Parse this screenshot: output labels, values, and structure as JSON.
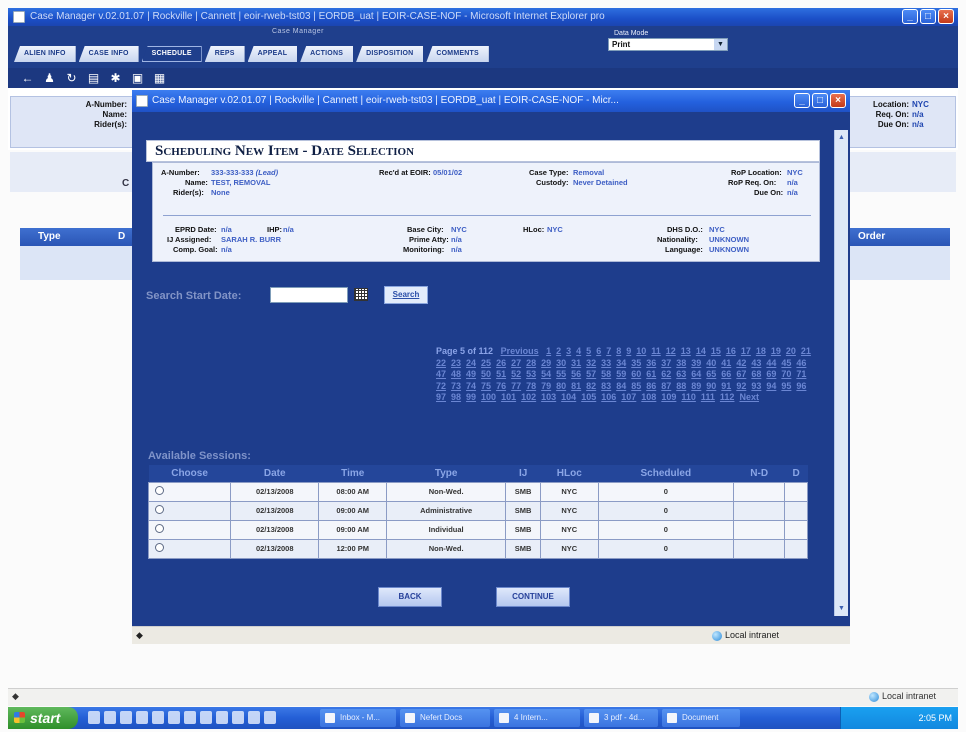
{
  "outer_window": {
    "title": "Case Manager v.02.01.07 | Rockville | Cannett | eoir-rweb-tst03 | EORDB_uat | EOIR-CASE-NOF - Microsoft Internet Explorer pro",
    "header_label": "Case Manager",
    "data_mode_label": "Data Mode",
    "print_select_value": "Print",
    "tabs": [
      {
        "label": "Alien Info"
      },
      {
        "label": "Case Info"
      },
      {
        "label": "Schedule"
      },
      {
        "label": "Reps"
      },
      {
        "label": "Appeal"
      },
      {
        "label": "Actions"
      },
      {
        "label": "Disposition"
      },
      {
        "label": "Comments"
      }
    ],
    "toolbar_icons": [
      "back-arrow-icon",
      "person-icon",
      "refresh-icon",
      "document-icon",
      "settings-icon",
      "save-icon",
      "clipboard-icon"
    ],
    "bg_labels": {
      "a_number": "A-Number:",
      "name": "Name:",
      "riders": "Rider(s):"
    },
    "bg_right": {
      "location_label": "Location:",
      "location_value": "NYC",
      "req_label": "Req. On:",
      "req_value": "n/a",
      "due_label": "Due On:",
      "due_value": "n/a"
    },
    "bg_grid": {
      "type_label": "Type",
      "col2_label": "D",
      "order_label": "Order"
    },
    "bg_strip_letter": "C",
    "status_text": "Local intranet"
  },
  "modal": {
    "title": "Case Manager v.02.01.07 | Rockville | Cannett | eoir-rweb-tst03 | EORDB_uat | EOIR-CASE-NOF - Micr...",
    "header": "Scheduling New Item - Date Selection",
    "info": {
      "a_number_label": "A-Number:",
      "a_number_value": "333-333-333",
      "a_number_tag": "(Lead)",
      "recd_label": "Rec'd at EOIR:",
      "recd_value": "05/01/02",
      "case_type_label": "Case Type:",
      "case_type_value": "Removal",
      "rop_location_label": "RoP Location:",
      "rop_location_value": "NYC",
      "name_label": "Name:",
      "name_value": "TEST, REMOVAL",
      "custody_label": "Custody:",
      "custody_value": "Never Detained",
      "rop_req_label": "RoP Req. On:",
      "rop_req_value": "n/a",
      "riders_label": "Rider(s):",
      "riders_value": "None",
      "due_label": "Due On:",
      "due_value": "n/a",
      "eprd_label": "EPRD Date:",
      "eprd_value": "n/a",
      "ihp_label": "IHP:",
      "ihp_value": "n/a",
      "base_city_label": "Base City:",
      "base_city_value": "NYC",
      "hloc_label": "HLoc:",
      "hloc_value": "NYC",
      "dhs_label": "DHS D.O.:",
      "dhs_value": "NYC",
      "ij_label": "IJ Assigned:",
      "ij_value": "SARAH R. BURR",
      "prime_atty_label": "Prime Atty:",
      "prime_atty_value": "n/a",
      "nationality_label": "Nationality:",
      "nationality_value": "UNKNOWN",
      "comp_goal_label": "Comp. Goal:",
      "comp_goal_value": "n/a",
      "monitoring_label": "Monitoring:",
      "monitoring_value": "n/a",
      "language_label": "Language:",
      "language_value": "UNKNOWN"
    },
    "search": {
      "label": "Search Start Date:",
      "value": "",
      "go_label": "Search"
    },
    "pager": {
      "page_info": "Page 5 of 112",
      "previous": "Previous",
      "next": "Next",
      "pages": [
        "1",
        "2",
        "3",
        "4",
        "5",
        "6",
        "7",
        "8",
        "9",
        "10",
        "11",
        "12",
        "13",
        "14",
        "15",
        "16",
        "17",
        "18",
        "19",
        "20",
        "21",
        "22",
        "23",
        "24",
        "25",
        "26",
        "27",
        "28",
        "29",
        "30",
        "31",
        "32",
        "33",
        "34",
        "35",
        "36",
        "37",
        "38",
        "39",
        "40",
        "41",
        "42",
        "43",
        "44",
        "45",
        "46",
        "47",
        "48",
        "49",
        "50",
        "51",
        "52",
        "53",
        "54",
        "55",
        "56",
        "57",
        "58",
        "59",
        "60",
        "61",
        "62",
        "63",
        "64",
        "65",
        "66",
        "67",
        "68",
        "69",
        "70",
        "71",
        "72",
        "73",
        "74",
        "75",
        "76",
        "77",
        "78",
        "79",
        "80",
        "81",
        "82",
        "83",
        "84",
        "85",
        "86",
        "87",
        "88",
        "89",
        "90",
        "91",
        "92",
        "93",
        "94",
        "95",
        "96",
        "97",
        "98",
        "99",
        "100",
        "101",
        "102",
        "103",
        "104",
        "105",
        "106",
        "107",
        "108",
        "109",
        "110",
        "111",
        "112"
      ]
    },
    "sessions": {
      "label": "Available Sessions:",
      "columns": [
        "Choose",
        "Date",
        "Time",
        "Type",
        "IJ",
        "HLoc",
        "Scheduled",
        "N-D",
        "D"
      ],
      "rows": [
        {
          "date": "02/13/2008",
          "time": "08:00 AM",
          "type": "Non-Wed.",
          "ij": "SMB",
          "hloc": "NYC",
          "scheduled": "0",
          "nd": "",
          "d": ""
        },
        {
          "date": "02/13/2008",
          "time": "09:00 AM",
          "type": "Administrative",
          "ij": "SMB",
          "hloc": "NYC",
          "scheduled": "0",
          "nd": "",
          "d": ""
        },
        {
          "date": "02/13/2008",
          "time": "09:00 AM",
          "type": "Individual",
          "ij": "SMB",
          "hloc": "NYC",
          "scheduled": "0",
          "nd": "",
          "d": ""
        },
        {
          "date": "02/13/2008",
          "time": "12:00 PM",
          "type": "Non-Wed.",
          "ij": "SMB",
          "hloc": "NYC",
          "scheduled": "0",
          "nd": "",
          "d": ""
        }
      ]
    },
    "buttons": {
      "back": "Back",
      "continue": "Continue"
    },
    "status_text": "Local intranet"
  },
  "taskbar": {
    "start_label": "start",
    "tasks": [
      "Inbox - M...",
      "Nefert Docs",
      "4 Intern...",
      "3 pdf - 4d...",
      "Document"
    ],
    "clock": "2:05 PM"
  }
}
